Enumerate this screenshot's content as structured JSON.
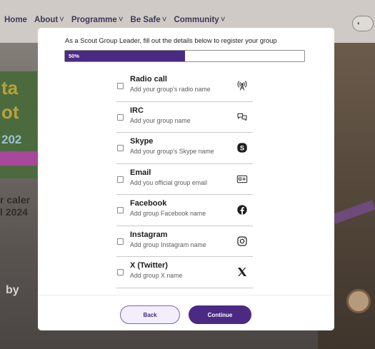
{
  "background": {
    "nav": [
      {
        "label": "Home",
        "has_chevron": false
      },
      {
        "label": "About",
        "has_chevron": true
      },
      {
        "label": "Programme",
        "has_chevron": true
      },
      {
        "label": "Be Safe",
        "has_chevron": true
      },
      {
        "label": "Community",
        "has_chevron": true
      }
    ],
    "nav_chevron": "˅",
    "left_text": "r caler\nl 2024",
    "left_by": "by"
  },
  "modal": {
    "instruction": "As a Scout Group Leader, fill out the details below to register your group",
    "progress": {
      "label": "50%",
      "value": 0.5
    },
    "items": [
      {
        "title": "Radio call",
        "placeholder": "Add your group's radio name",
        "icon": "radio-tower-icon"
      },
      {
        "title": "IRC",
        "placeholder": "Add your group name",
        "icon": "chat-bubbles-icon"
      },
      {
        "title": "Skype",
        "placeholder": "Add your group's Skype name",
        "icon": "skype-icon"
      },
      {
        "title": "Email",
        "placeholder": "Add you official group email",
        "icon": "email-card-icon"
      },
      {
        "title": "Facebook",
        "placeholder": "Add group Facebook name",
        "icon": "facebook-icon"
      },
      {
        "title": "Instagram",
        "placeholder": "Add group Instagram name",
        "icon": "instagram-icon"
      },
      {
        "title": "X (Twitter)",
        "placeholder": "Add group X name",
        "icon": "x-twitter-icon"
      }
    ],
    "buttons": {
      "back": "Back",
      "continue": "Continue"
    }
  },
  "colors": {
    "brand_purple": "#4b2a84",
    "back_button_tint": "#f3eefb"
  }
}
